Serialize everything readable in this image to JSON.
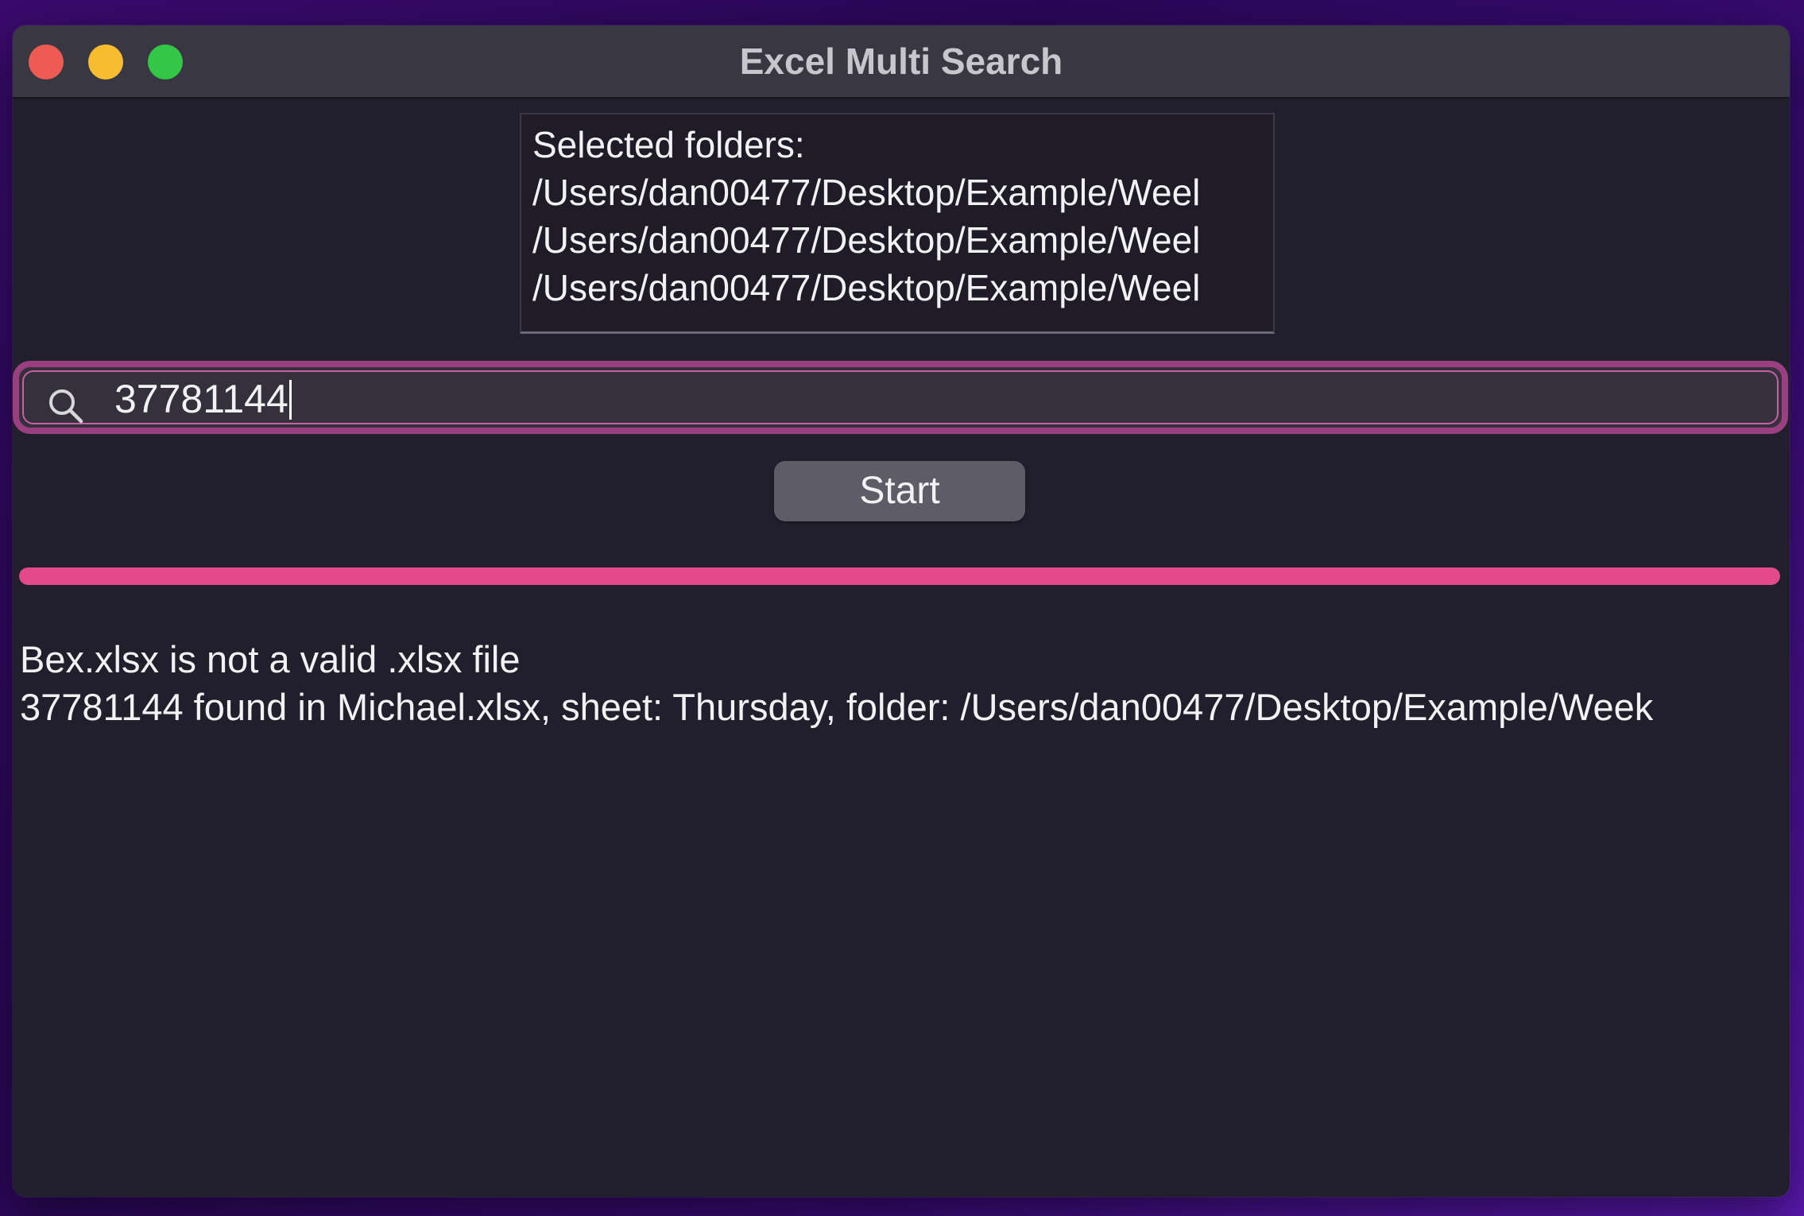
{
  "window": {
    "title": "Excel Multi Search"
  },
  "folders": {
    "header": "Selected folders:",
    "paths": [
      "/Users/dan00477/Desktop/Example/Weel",
      "/Users/dan00477/Desktop/Example/Weel",
      "/Users/dan00477/Desktop/Example/Weel"
    ]
  },
  "search": {
    "value": "37781144",
    "icon": "search-icon",
    "focus_color": "#c65fa6"
  },
  "start_button": {
    "label": "Start"
  },
  "progress": {
    "value": 1.0,
    "color": "#e24a8b"
  },
  "log": {
    "lines": [
      "Bex.xlsx is not a valid .xlsx file",
      "37781144 found in Michael.xlsx, sheet: Thursday, folder: /Users/dan00477/Desktop/Example/Week"
    ]
  }
}
